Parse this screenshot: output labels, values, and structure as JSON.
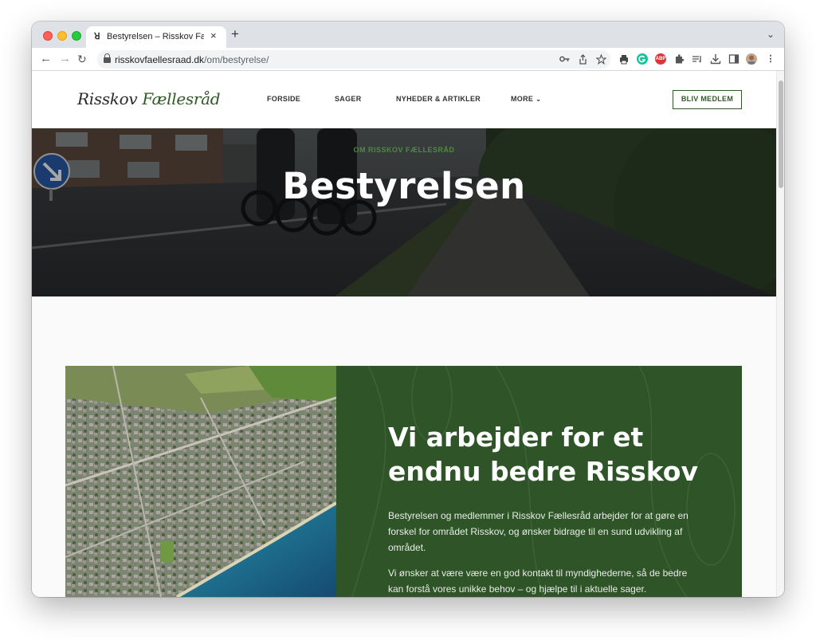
{
  "browser": {
    "tab_favicon": "ꓤ",
    "tab_title": "Bestyrelsen – Risskov Fællesråd",
    "tab_close": "×",
    "new_tab": "+",
    "tab_dropdown": "⌄",
    "back": "←",
    "forward": "→",
    "reload": "↻",
    "url_domain": "risskovfaellesraad.dk",
    "url_path": "/om/bestyrelse/",
    "extensions": {
      "abp_label": "ABP",
      "grammarly_color": "#15c39a",
      "abp_color": "#e0333a"
    }
  },
  "site": {
    "logo_main": "Risskov ",
    "logo_accent": "Fællesråd",
    "nav": [
      "FORSIDE",
      "SAGER",
      "NYHEDER & ARTIKLER",
      "MORE"
    ],
    "more_chevron": "⌄",
    "cta": "BLIV MEDLEM",
    "accent_color": "#2f5a27"
  },
  "hero": {
    "eyebrow": "OM RISSKOV FÆLLESRÅD",
    "title": "Bestyrelsen"
  },
  "intro": {
    "heading": "Vi arbejder for et endnu bedre Risskov",
    "paragraph_1": "Bestyrelsen og medlemmer i Risskov Fællesråd arbejder for at gøre en forskel for området Risskov, og ønsker bidrage til en sund udvikling af området.",
    "paragraph_2": "Vi ønsker at være være en god kontakt til myndighederne, så de bedre kan forstå vores unikke behov – og hjælpe til i aktuelle sager."
  }
}
